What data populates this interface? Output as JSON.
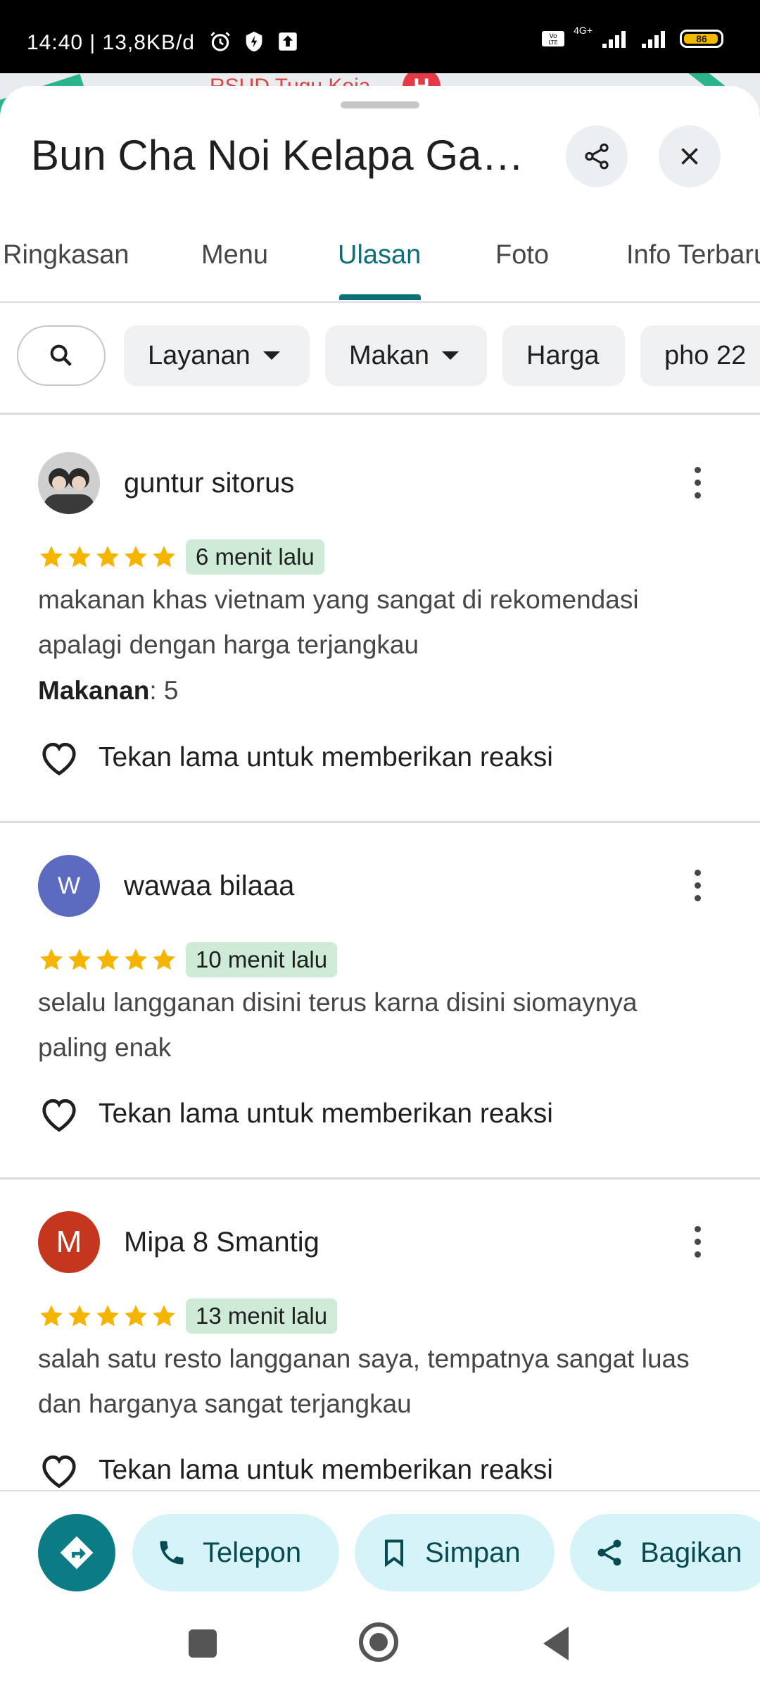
{
  "status_bar": {
    "time": "14:40",
    "speed": "13,8KB/d",
    "network": "4G+",
    "battery": "86"
  },
  "map": {
    "label": "RSUD Tugu Koja",
    "pin": "H"
  },
  "place": {
    "title": "Bun Cha Noi Kelapa Gad..."
  },
  "tabs": [
    {
      "label": "Ringkasan"
    },
    {
      "label": "Menu"
    },
    {
      "label": "Ulasan",
      "active": true
    },
    {
      "label": "Foto"
    },
    {
      "label": "Info Terbaru"
    }
  ],
  "filters": [
    {
      "label": "Layanan",
      "dropdown": true
    },
    {
      "label": "Makan",
      "dropdown": true
    },
    {
      "label": "Harga"
    },
    {
      "label": "pho 22"
    }
  ],
  "reviews": [
    {
      "name": "guntur sitorus",
      "avatar_initial": "",
      "avatar_color": "#6b6b6b",
      "rating": 5,
      "time": "6 menit lalu",
      "text": "makanan khas vietnam yang sangat di rekomendasi apalagi dengan harga terjangkau",
      "meta_label": "Makanan",
      "meta_value": ": 5",
      "reaction": "Tekan lama untuk memberikan reaksi"
    },
    {
      "name": "wawaa bilaaa",
      "avatar_initial": "W",
      "avatar_color": "#5c6bc0",
      "rating": 5,
      "time": "10 menit lalu",
      "text": "selalu langganan disini terus karna disini siomaynya paling enak",
      "reaction": "Tekan lama untuk memberikan reaksi"
    },
    {
      "name": "Mipa 8 Smantig",
      "avatar_initial": "M",
      "avatar_color": "#c4361e",
      "rating": 5,
      "time": "13 menit lalu",
      "text": "salah satu resto langganan saya, tempatnya sangat luas dan harganya sangat terjangkau",
      "reaction": "Tekan lama untuk memberikan reaksi"
    }
  ],
  "actions": {
    "call": "Telepon",
    "save": "Simpan",
    "share": "Bagikan"
  },
  "colors": {
    "accent": "#0b6e78",
    "star": "#f4b400",
    "time_badge": "#cdebd6",
    "action_pill": "#d6f4f7"
  }
}
